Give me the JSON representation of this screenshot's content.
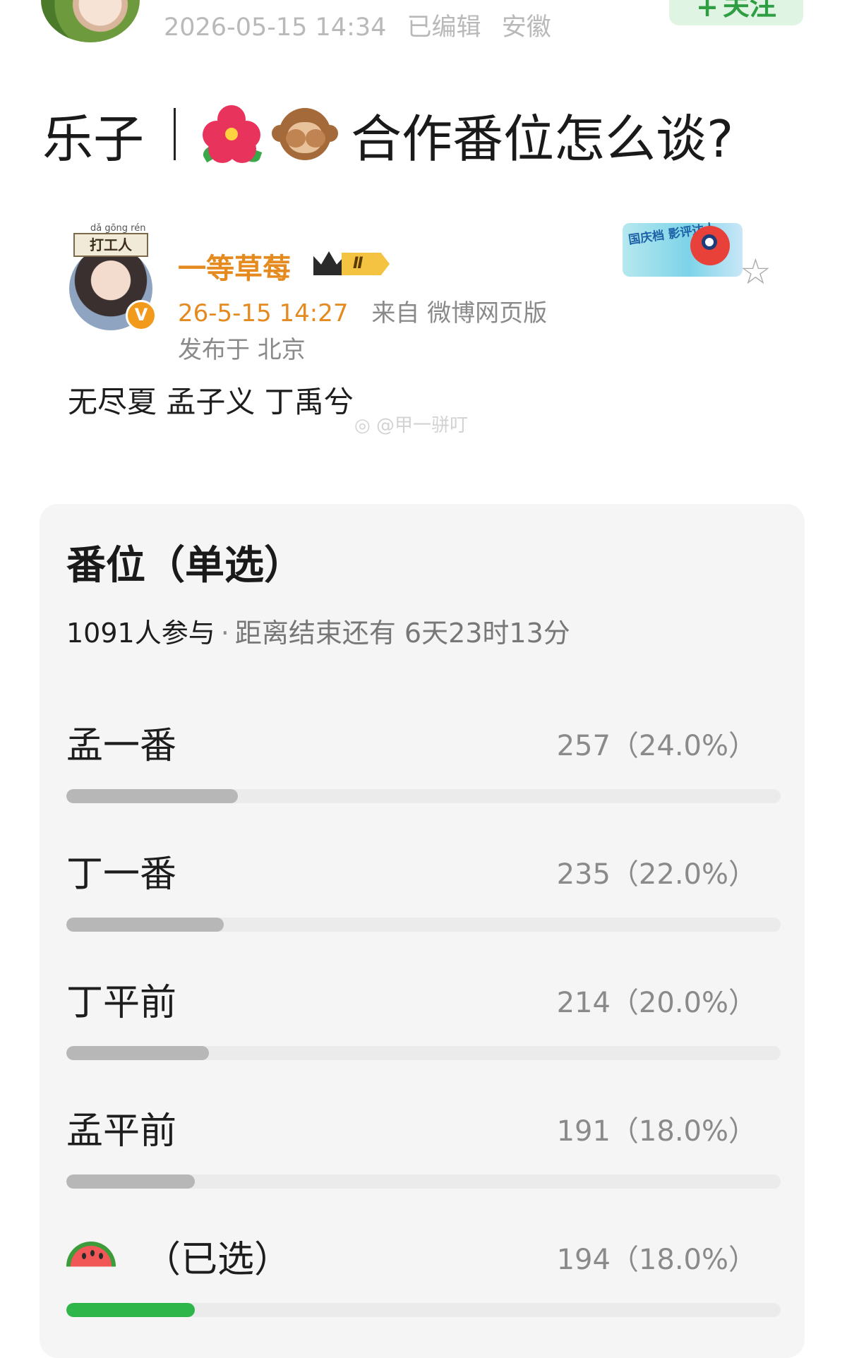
{
  "header": {
    "timestamp": "2026-05-15 14:34",
    "edited": "已编辑",
    "location": "安徽",
    "follow_label": "关注"
  },
  "post": {
    "title_prefix": "乐子",
    "title_text": "合作番位怎么谈?",
    "title_icons": [
      "hibiscus-icon",
      "see-no-evil-monkey-icon"
    ]
  },
  "quoted_post": {
    "avatar_badge": "打工人",
    "avatar_badge_pinyin": "dǎ gōng rén",
    "username": "一等草莓",
    "member_level": "Ⅱ",
    "time": "26-5-15 14:27",
    "source": "来自 微博网页版",
    "location": "发布于 北京",
    "activity_badge": "国庆档 影评达人",
    "body": "无尽夏 孟子义 丁禹兮",
    "watermark": "@甲一骈叮"
  },
  "poll": {
    "title": "番位（单选）",
    "participants": "1091人参与",
    "separator": "·",
    "deadline": "距离结束还有 6天23时13分",
    "options": [
      {
        "label": "孟一番",
        "result": "257（24.0%）",
        "percent": 24.0,
        "selected": false
      },
      {
        "label": "丁一番",
        "result": "235（22.0%）",
        "percent": 22.0,
        "selected": false
      },
      {
        "label": "丁平前",
        "result": "214（20.0%）",
        "percent": 20.0,
        "selected": false
      },
      {
        "label": "孟平前",
        "result": "191（18.0%）",
        "percent": 18.0,
        "selected": false
      },
      {
        "label": "（已选）",
        "icon": "watermelon-icon",
        "result": "194（18.0%）",
        "percent": 18.0,
        "selected": true
      }
    ]
  },
  "colors": {
    "accent_green": "#2fb64a",
    "username_orange": "#e48a1f",
    "bar_gray": "#b7b7b7"
  }
}
